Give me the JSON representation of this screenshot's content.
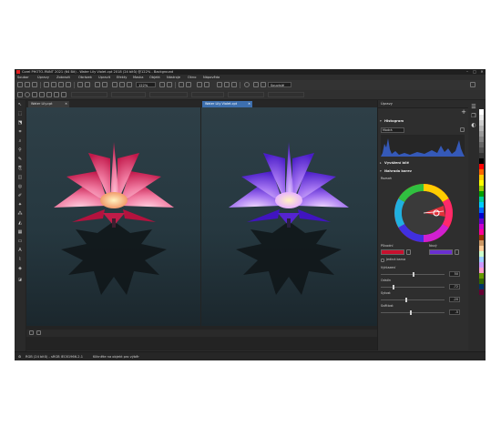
{
  "window": {
    "title": "Corel PHOTO-PAINT 2021 (64 Bit) - Water Lily Violet.cpt 2018 (24 bitů) @122% - Background",
    "minimize": "–",
    "maximize": "□",
    "close": "✕"
  },
  "menu": [
    "Soubor",
    "Úpravy",
    "Zobrazit",
    "Obrázek",
    "Upravit",
    "Efekty",
    "Maska",
    "Objekt",
    "Nástroje",
    "Okno",
    "Nápověda"
  ],
  "toolbar": {
    "zoom_value": "122%",
    "fill_mode": "Souvislé"
  },
  "tabs": {
    "left": "Water Lily.cpt",
    "right": "Water Lily Violet.cpt",
    "close": "✕"
  },
  "docker": {
    "title": "Úpravy",
    "histogram_title": "Histogram",
    "channel": "Modrá",
    "auto_white_title": "Vyvážení bílé",
    "replace_title": "Nahrada barev",
    "source_label": "Rozsah",
    "original_label": "Původní",
    "new_label": "Nový",
    "smooth_label": "Jediná barva",
    "sliders": [
      {
        "label": "Vyhlazení",
        "value": "50"
      },
      {
        "label": "Odstín",
        "value": "-72"
      },
      {
        "label": "Sytost",
        "value": "-20"
      },
      {
        "label": "Světlost",
        "value": "-5"
      }
    ]
  },
  "status": {
    "color_info": "RGB (24 bitů) - sRGB IEC61966-2.1",
    "hint": "Klikněte na objekt pro výběr"
  },
  "colors": {
    "accent": "#3d6fae",
    "original_swatch": "#c8102e",
    "new_swatch": "#6a2fd0"
  }
}
